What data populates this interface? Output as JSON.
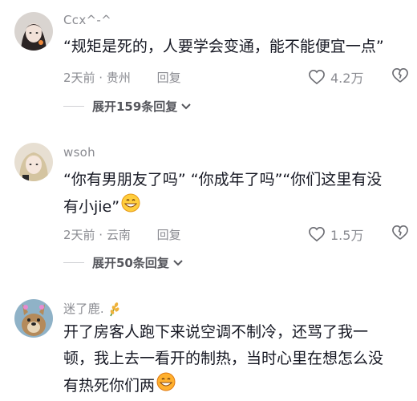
{
  "comments": [
    {
      "username": "Ccx^-^",
      "text": "“规矩是死的，人要学会变通，能不能便宜一点”",
      "time_location": "2天前 · 贵州",
      "reply_label": "回复",
      "likes": "4.2万",
      "expand_label": "展开159条回复"
    },
    {
      "username": "wsoh",
      "text_line1": "“你有男朋友了吗” “你成年了吗”“你们这里有没",
      "text_line2": "有小jie”",
      "time_location": "2天前 · 云南",
      "reply_label": "回复",
      "likes": "1.5万",
      "expand_label": "展开50条回复"
    },
    {
      "username": "迷了鹿.",
      "text_line1": "开了房客人跑下来说空调不制冷，还骂了我一",
      "text_line2": "顿，我上去一看开的制热，当时心里在想怎么没",
      "text_line3": "有热死你们两"
    }
  ],
  "colors": {
    "text": "#161823",
    "meta": "#8a8b91"
  },
  "icons": {
    "like": "heart-outline-icon",
    "dislike": "broken-heart-icon",
    "expand": "chevron-down-icon",
    "emoji": "grinning-face-icon"
  }
}
